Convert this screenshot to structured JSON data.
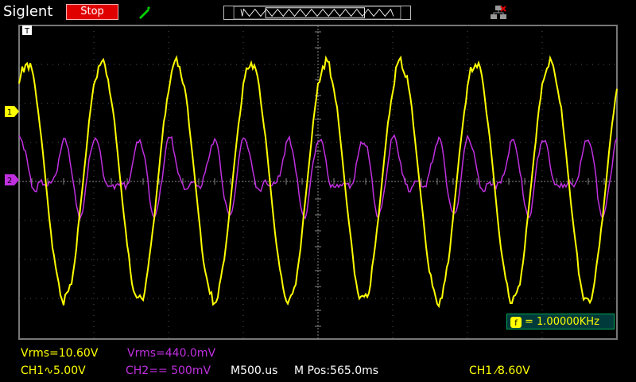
{
  "app": {
    "brand": "Siglent"
  },
  "toolbar": {
    "run_state": "Stop",
    "probe_icon": "probe-icon",
    "network_icon": "network-icon",
    "timebase_map_icon": "timebase-map-icon"
  },
  "markers": {
    "trigger": "T",
    "ch1": "1",
    "ch2": "2"
  },
  "measurements": {
    "ch1_vrms": "Vrms=10.60V",
    "ch2_vrms": "Vrms=440.0mV",
    "ch1_scale": "CH1∿5.00V",
    "ch2_scale": "CH2== 500mV",
    "time_scale": "M500.us",
    "time_pos": "M Pos:565.0ms",
    "trigger": "CH1 ⁄8.60V"
  },
  "freq_counter": {
    "icon": "f",
    "value": "= 1.00000KHz"
  },
  "colors": {
    "ch1": "#ffff00",
    "ch2": "#c030e0",
    "grid": "#6f6f6f",
    "run_stop": "#e00000"
  }
}
